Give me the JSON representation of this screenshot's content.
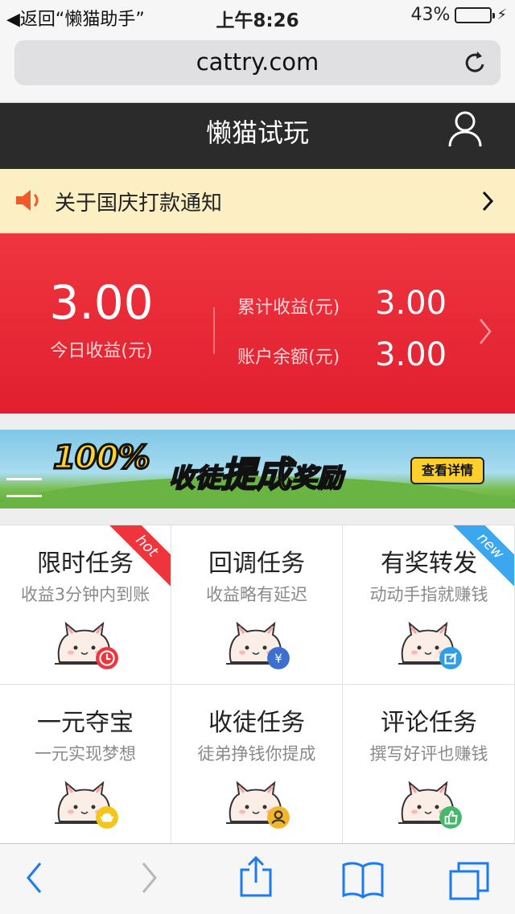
{
  "status_bar": {
    "back_label": "返回“懒猫助手”",
    "time": "上午8:26",
    "battery": "43%",
    "battery_level": 0.43
  },
  "browser": {
    "url": "cattry.com"
  },
  "header": {
    "title": "懒猫试玩"
  },
  "notice": {
    "text": "关于国庆打款通知"
  },
  "earnings": {
    "today_value": "3.00",
    "today_label": "今日收益(元)",
    "total_label": "累计收益(元)",
    "total_value": "3.00",
    "balance_label": "账户余额(元)",
    "balance_value": "3.00"
  },
  "banner": {
    "percent": "100%",
    "text_a": "收徒",
    "text_b": "提成",
    "text_c": "奖励",
    "button": "查看详情"
  },
  "tasks": [
    {
      "title": "限时任务",
      "subtitle": "收益3分钟内到账",
      "ribbon": "hot",
      "badge_icon": "clock-icon",
      "badge_color": "#f0343e"
    },
    {
      "title": "回调任务",
      "subtitle": "收益略有延迟",
      "ribbon": "",
      "badge_icon": "yen-icon",
      "badge_color": "#3d6fd1"
    },
    {
      "title": "有奖转发",
      "subtitle": "动动手指就赚钱",
      "ribbon": "new",
      "badge_icon": "share-icon",
      "badge_color": "#2f9ee6"
    },
    {
      "title": "一元夺宝",
      "subtitle": "一元实现梦想",
      "ribbon": "",
      "badge_icon": "ingot-icon",
      "badge_color": "#f5c518"
    },
    {
      "title": "收徒任务",
      "subtitle": "徒弟挣钱你提成",
      "ribbon": "",
      "badge_icon": "person-icon",
      "badge_color": "#f5b52a"
    },
    {
      "title": "评论任务",
      "subtitle": "撰写好评也赚钱",
      "ribbon": "",
      "badge_icon": "thumbs-up-icon",
      "badge_color": "#45b86a"
    }
  ],
  "colors": {
    "accent_red": "#e11f2e",
    "header_dark": "#2b2b2b",
    "notice_bg": "#fbefc3",
    "ios_blue": "#1a7bf5"
  }
}
